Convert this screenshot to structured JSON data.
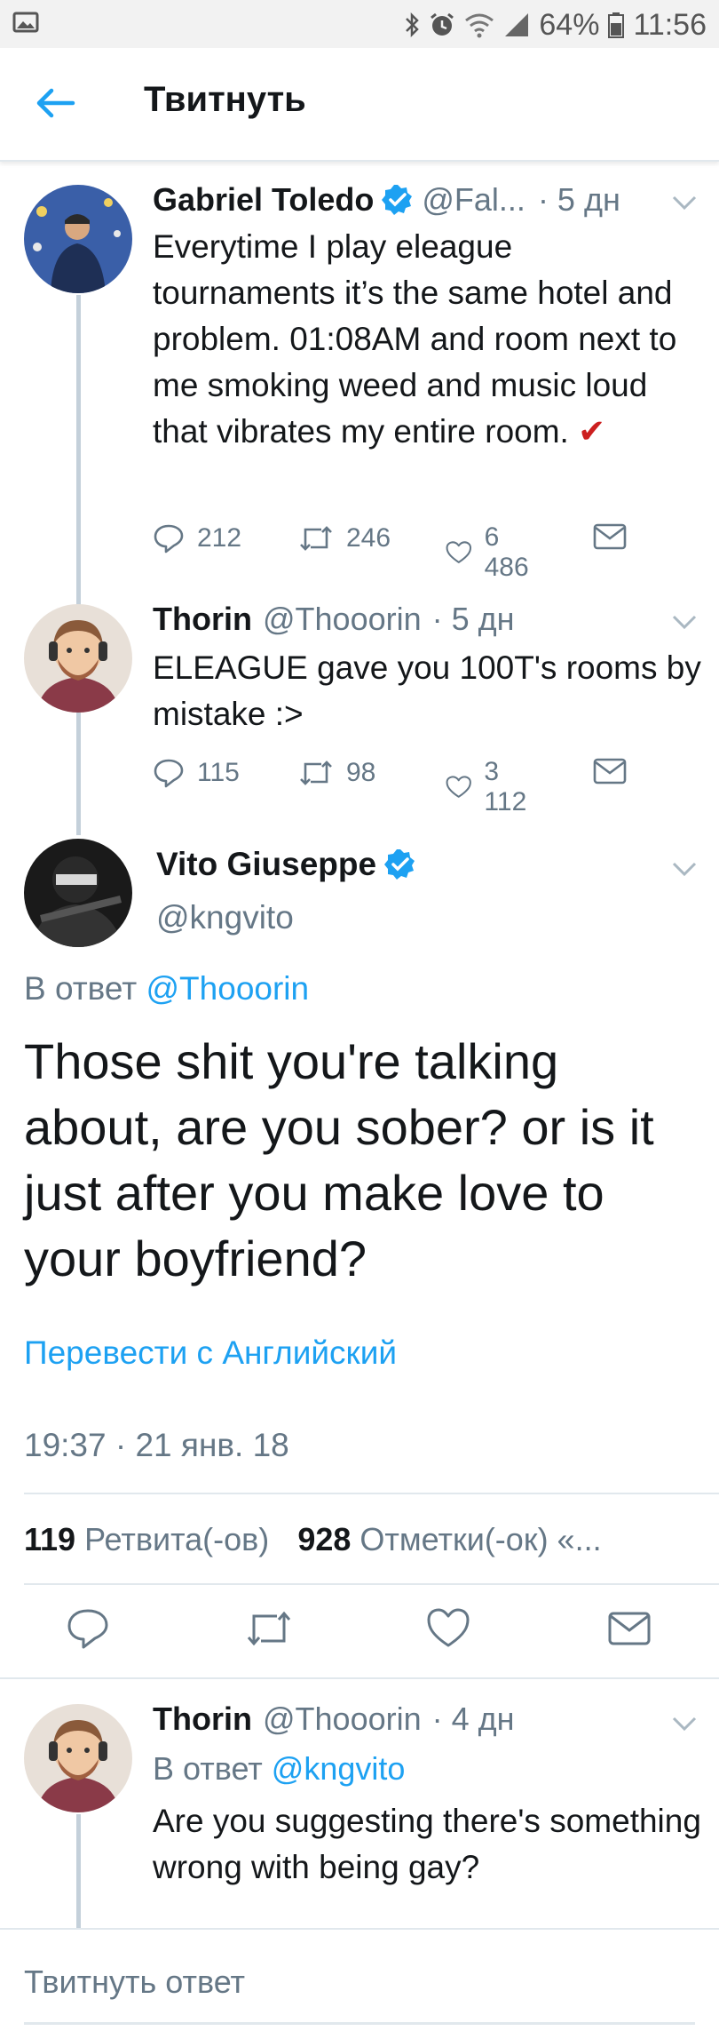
{
  "status_bar": {
    "battery": "64%",
    "time": "11:56"
  },
  "header": {
    "title": "Твитнуть"
  },
  "tweets": [
    {
      "name": "Gabriel Toledo",
      "verified": true,
      "handle": "@Fal...",
      "time": "· 5 дн",
      "text": "Everytime I play eleague tournaments  it’s the same hotel and problem. 01:08AM and room next to me smoking weed and music loud that vibrates my entire room. ✔",
      "replies": "212",
      "retweets": "246",
      "likes": "6 486"
    },
    {
      "name": "Thorin",
      "handle": "@Thooorin",
      "time": "· 5 дн",
      "text": "ELEAGUE gave you 100T's rooms by mistake :>",
      "replies": "115",
      "retweets": "98",
      "likes": "3 112"
    }
  ],
  "main_tweet": {
    "name": "Vito Giuseppe",
    "verified": true,
    "handle": "@kngvito",
    "reply_prefix": "В ответ",
    "reply_handle": "@Thooorin",
    "text": "Those shit you're talking about, are you sober? or is it just after you make love to your boyfriend?",
    "translate": "Перевести с Английский",
    "timestamp": "19:37 · 21 янв. 18",
    "retweet_count": "119",
    "retweet_label": "Ретвита(-ов)",
    "like_count": "928",
    "like_label": "Отметки(-ок) «..."
  },
  "reply_tweet": {
    "name": "Thorin",
    "handle": "@Thooorin",
    "time": "· 4 дн",
    "reply_prefix": "В ответ",
    "reply_handle": "@kngvito",
    "text": "Are you suggesting there's something wrong with being gay?"
  },
  "compose": {
    "placeholder": "Твитнуть ответ"
  },
  "colors": {
    "accent": "#1da1f2",
    "secondary_text": "#657786",
    "check_red": "#cc1f1f"
  },
  "icons": [
    "image-icon",
    "bluetooth-icon",
    "alarm-icon",
    "wifi-icon",
    "signal-icon",
    "battery-icon",
    "back-arrow-icon",
    "verified-icon",
    "chevron-down-icon",
    "reply-icon",
    "retweet-icon",
    "like-icon",
    "message-icon"
  ]
}
